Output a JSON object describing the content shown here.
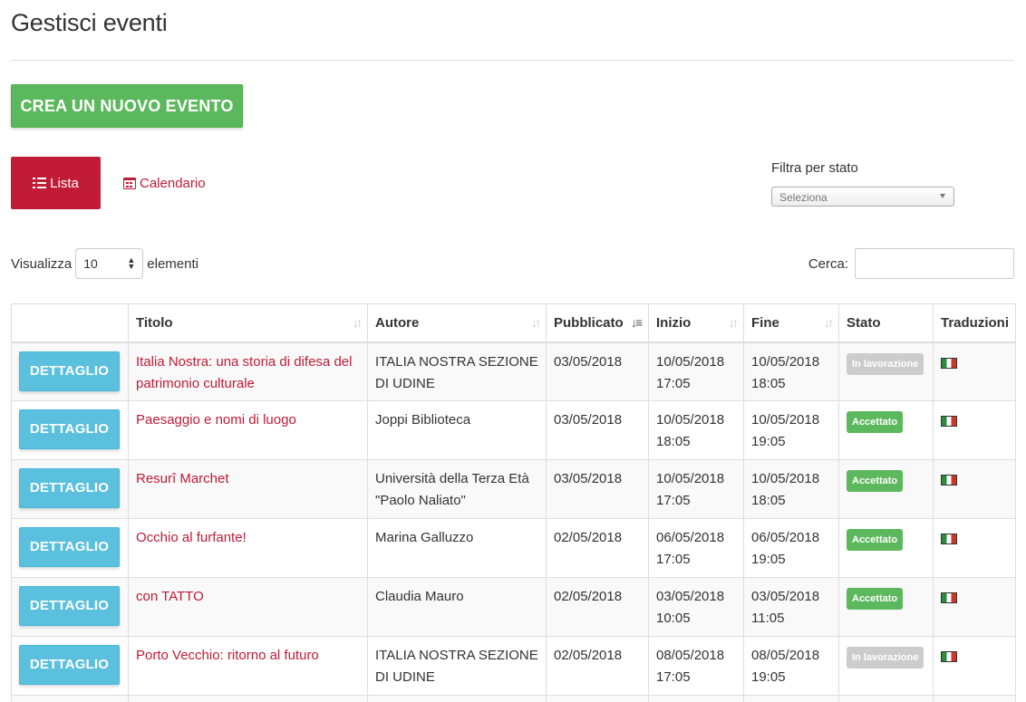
{
  "page": {
    "title": "Gestisci eventi"
  },
  "actions": {
    "create_label": "CREA UN NUOVO EVENTO"
  },
  "view_tabs": {
    "list_label": "Lista",
    "calendar_label": "Calendario"
  },
  "filter": {
    "label": "Filtra per stato",
    "placeholder": "Seleziona"
  },
  "length": {
    "prefix": "Visualizza",
    "value": "10",
    "suffix": "elementi"
  },
  "search": {
    "label": "Cerca:",
    "value": ""
  },
  "table": {
    "headers": [
      "",
      "Titolo",
      "Autore",
      "Pubblicato",
      "Inizio",
      "Fine",
      "Stato",
      "Traduzioni"
    ],
    "sorted_column": "Pubblicato",
    "detail_label": "DETTAGLIO",
    "rows": [
      {
        "title": "Italia Nostra: una storia di difesa del patrimonio culturale",
        "author": "ITALIA NOSTRA SEZIONE DI UDINE",
        "published": "03/05/2018",
        "start": "10/05/2018 17:05",
        "end": "10/05/2018 18:05",
        "status": "In lavorazione"
      },
      {
        "title": "Paesaggio e nomi di luogo",
        "author": "Joppi Biblioteca",
        "published": "03/05/2018",
        "start": "10/05/2018 18:05",
        "end": "10/05/2018 19:05",
        "status": "Accettato"
      },
      {
        "title": "Resurî Marchet",
        "author": "Università della Terza Età \"Paolo Naliato\"",
        "published": "03/05/2018",
        "start": "10/05/2018 17:05",
        "end": "10/05/2018 18:05",
        "status": "Accettato"
      },
      {
        "title": "Occhio al furfante!",
        "author": "Marina Galluzzo",
        "published": "02/05/2018",
        "start": "06/05/2018 17:05",
        "end": "06/05/2018 19:05",
        "status": "Accettato"
      },
      {
        "title": "con TATTO",
        "author": "Claudia Mauro",
        "published": "02/05/2018",
        "start": "03/05/2018 10:05",
        "end": "03/05/2018 11:05",
        "status": "Accettato"
      },
      {
        "title": "Porto Vecchio: ritorno al futuro",
        "author": "ITALIA NOSTRA SEZIONE DI UDINE",
        "published": "02/05/2018",
        "start": "08/05/2018 17:05",
        "end": "08/05/2018 19:05",
        "status": "In lavorazione"
      }
    ]
  },
  "colors": {
    "accent": "#c11b37",
    "success": "#5cb85c",
    "info": "#5bc0de",
    "muted_badge": "#cccccc"
  },
  "icons": {
    "list": "list-icon",
    "calendar": "calendar-icon",
    "flag": "flag-it-icon"
  }
}
